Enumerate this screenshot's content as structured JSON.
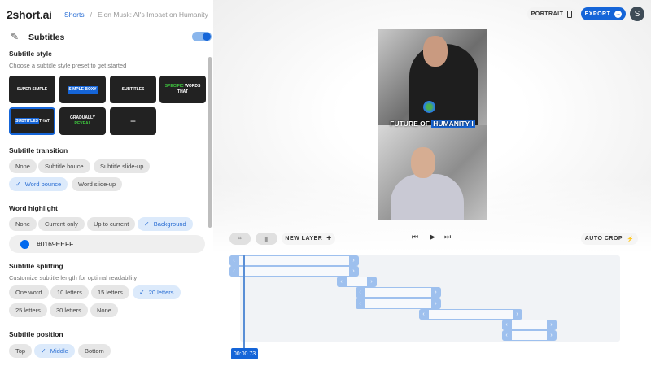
{
  "header": {
    "logo": "2short.ai",
    "breadcrumb": [
      "Shorts",
      "Elon Musk: AI's Impact on Humanity"
    ],
    "portrait_label": "PORTRAIT",
    "export_label": "EXPORT",
    "avatar_initial": "S"
  },
  "panel": {
    "title": "Subtitles",
    "toggle_on": true,
    "style": {
      "title": "Subtitle style",
      "subtitle": "Choose a subtitle style preset to get started",
      "presets": [
        {
          "label": "SUPER SIMPLE"
        },
        {
          "label": "SIMPLE BOXY"
        },
        {
          "label": "SUBTITLES"
        },
        {
          "a": "SPECIFIC",
          "b": "WORDS THAT"
        },
        {
          "a": "SUBTITLES",
          "b": "THAT"
        },
        {
          "a": "GRADUALLY",
          "b": "REVEAL"
        },
        {
          "label": "+"
        }
      ]
    },
    "transition": {
      "title": "Subtitle transition",
      "options": [
        "None",
        "Subtitle bouce",
        "Subtitle slide-up",
        "Word bounce",
        "Word slide-up"
      ],
      "selected": "Word bounce"
    },
    "highlight": {
      "title": "Word highlight",
      "options": [
        "None",
        "Current only",
        "Up to current",
        "Background"
      ],
      "selected": "Background",
      "color": "#0169EEFF"
    },
    "splitting": {
      "title": "Subtitle splitting",
      "subtitle": "Customize subtitle length for optimal readability",
      "options": [
        "One word",
        "10 letters",
        "15 letters",
        "20 letters",
        "25 letters",
        "30 letters",
        "None"
      ],
      "selected": "20 letters"
    },
    "position": {
      "title": "Subtitle position",
      "options": [
        "Top",
        "Middle",
        "Bottom"
      ],
      "selected": "Middle"
    }
  },
  "video": {
    "caption_plain": "FUTURE OF ",
    "caption_highlight": "HUMANITY I"
  },
  "toolbar": {
    "new_layer": "NEW LAYER",
    "auto_crop": "AUTO CROP"
  },
  "timeline": {
    "current_time": "00:00.73"
  }
}
